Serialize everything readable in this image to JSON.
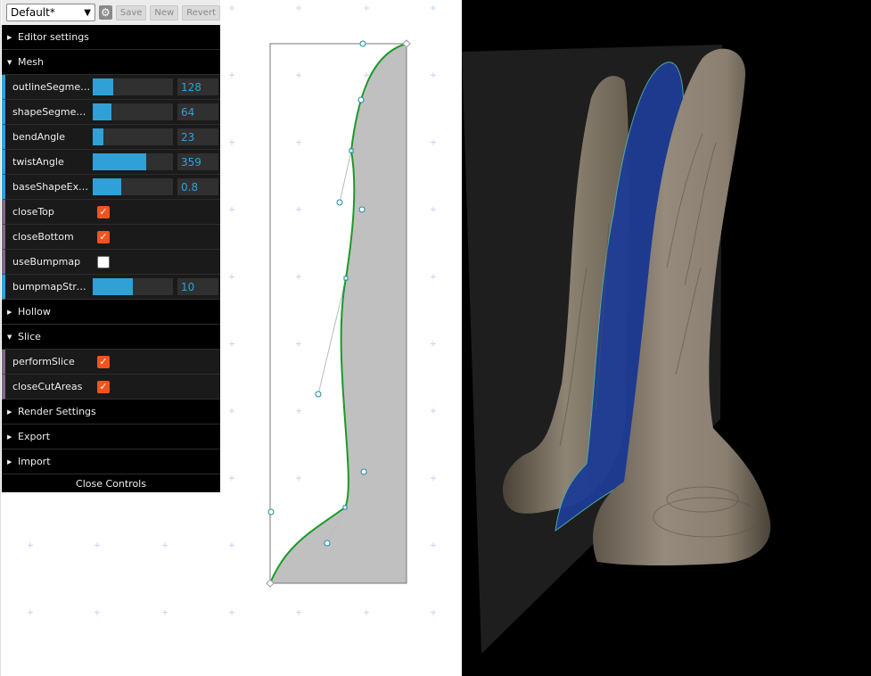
{
  "gui": {
    "preset": "Default*",
    "save_label": "Save",
    "new_label": "New",
    "revert_label": "Revert",
    "gear_icon": "gear-icon",
    "close_label": "Close Controls",
    "folders": {
      "editor": "Editor settings",
      "mesh": "Mesh",
      "hollow": "Hollow",
      "slice": "Slice",
      "render": "Render Settings",
      "export": "Export",
      "import": "Import"
    },
    "mesh": {
      "outlineSegments": {
        "label": "outlineSegme…",
        "value": "128",
        "fill": 0.25
      },
      "shapeSegments": {
        "label": "shapeSegmen…",
        "value": "64",
        "fill": 0.23
      },
      "bendAngle": {
        "label": "bendAngle",
        "value": "23",
        "fill": 0.13
      },
      "twistAngle": {
        "label": "twistAngle",
        "value": "359",
        "fill": 0.67
      },
      "baseShapeExc": {
        "label": "baseShapeExc…",
        "value": "0.8",
        "fill": 0.35
      },
      "closeTop": {
        "label": "closeTop",
        "checked": true
      },
      "closeBottom": {
        "label": "closeBottom",
        "checked": true
      },
      "useBumpmap": {
        "label": "useBumpmap",
        "checked": false
      },
      "bumpmapStrength": {
        "label": "bumpmapStre…",
        "value": "10",
        "fill": 0.5
      }
    },
    "slice": {
      "performSlice": {
        "label": "performSlice",
        "checked": true
      },
      "closeCutAreas": {
        "label": "closeCutAreas",
        "checked": true
      }
    }
  },
  "colors": {
    "accent_blue": "#2fa1d6",
    "checkbox_orange": "#f0541e",
    "curve_green": "#1a9a2a",
    "shape_gray": "#c0c0c0",
    "slice_blue": "#1e3c96"
  }
}
